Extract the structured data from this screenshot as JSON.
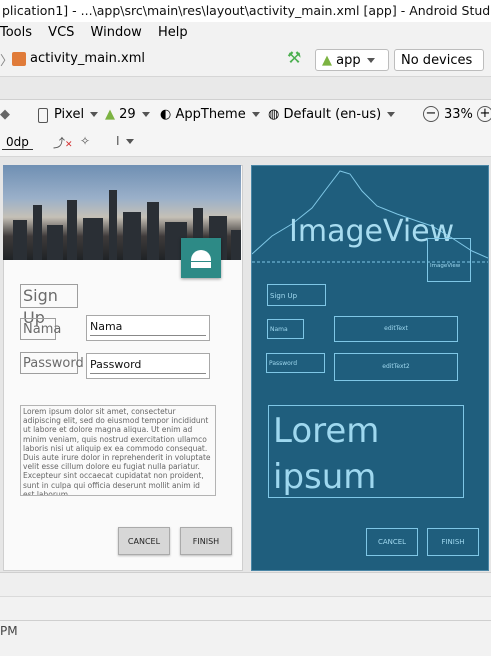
{
  "window": {
    "title": "plication1] - ...\\app\\src\\main\\res\\layout\\activity_main.xml [app] - Android Studio"
  },
  "menu": {
    "items": [
      "Tools",
      "VCS",
      "Window",
      "Help"
    ]
  },
  "nav": {
    "file_name": "activity_main.xml",
    "run_config": "app",
    "device_select": "No devices"
  },
  "design_toolbar": {
    "device": "Pixel",
    "api": "29",
    "theme": "AppTheme",
    "locale": "Default (en-us)",
    "zoom": "33%",
    "margin": "0dp"
  },
  "preview": {
    "sign_up": "Sign Up",
    "name_label": "Nama",
    "name_value": "Nama",
    "password_label": "Password",
    "password_value": "Password",
    "lorem": "Lorem ipsum dolor sit amet, consectetur adipiscing elit, sed do eiusmod tempor incididunt ut labore et dolore magna aliqua. Ut enim ad minim veniam, quis nostrud exercitation ullamco laboris nisi ut aliquip ex ea commodo consequat. Duis aute irure dolor in reprehenderit in voluptate velit esse cillum dolore eu fugiat nulla pariatur. Excepteur sint occaecat cupidatat non proident, sunt in culpa qui officia deserunt mollit anim id est laborum.",
    "cancel": "CANCEL",
    "finish": "FINISH"
  },
  "blueprint": {
    "imageview_big": "ImageView",
    "imageview_small": "ImageView",
    "sign_up": "Sign Up",
    "nama": "Nama",
    "edittext": "editText",
    "password": "Password",
    "edittext2": "editText2",
    "lorem": "Lorem ipsum dolor",
    "cancel": "CANCEL",
    "finish": "FINISH"
  },
  "status": {
    "text": "PM"
  },
  "colors": {
    "blueprint_bg": "#1f5e7d",
    "blueprint_line": "#7fc7e6",
    "fab": "#2d8a86",
    "android_green": "#7cb342"
  }
}
